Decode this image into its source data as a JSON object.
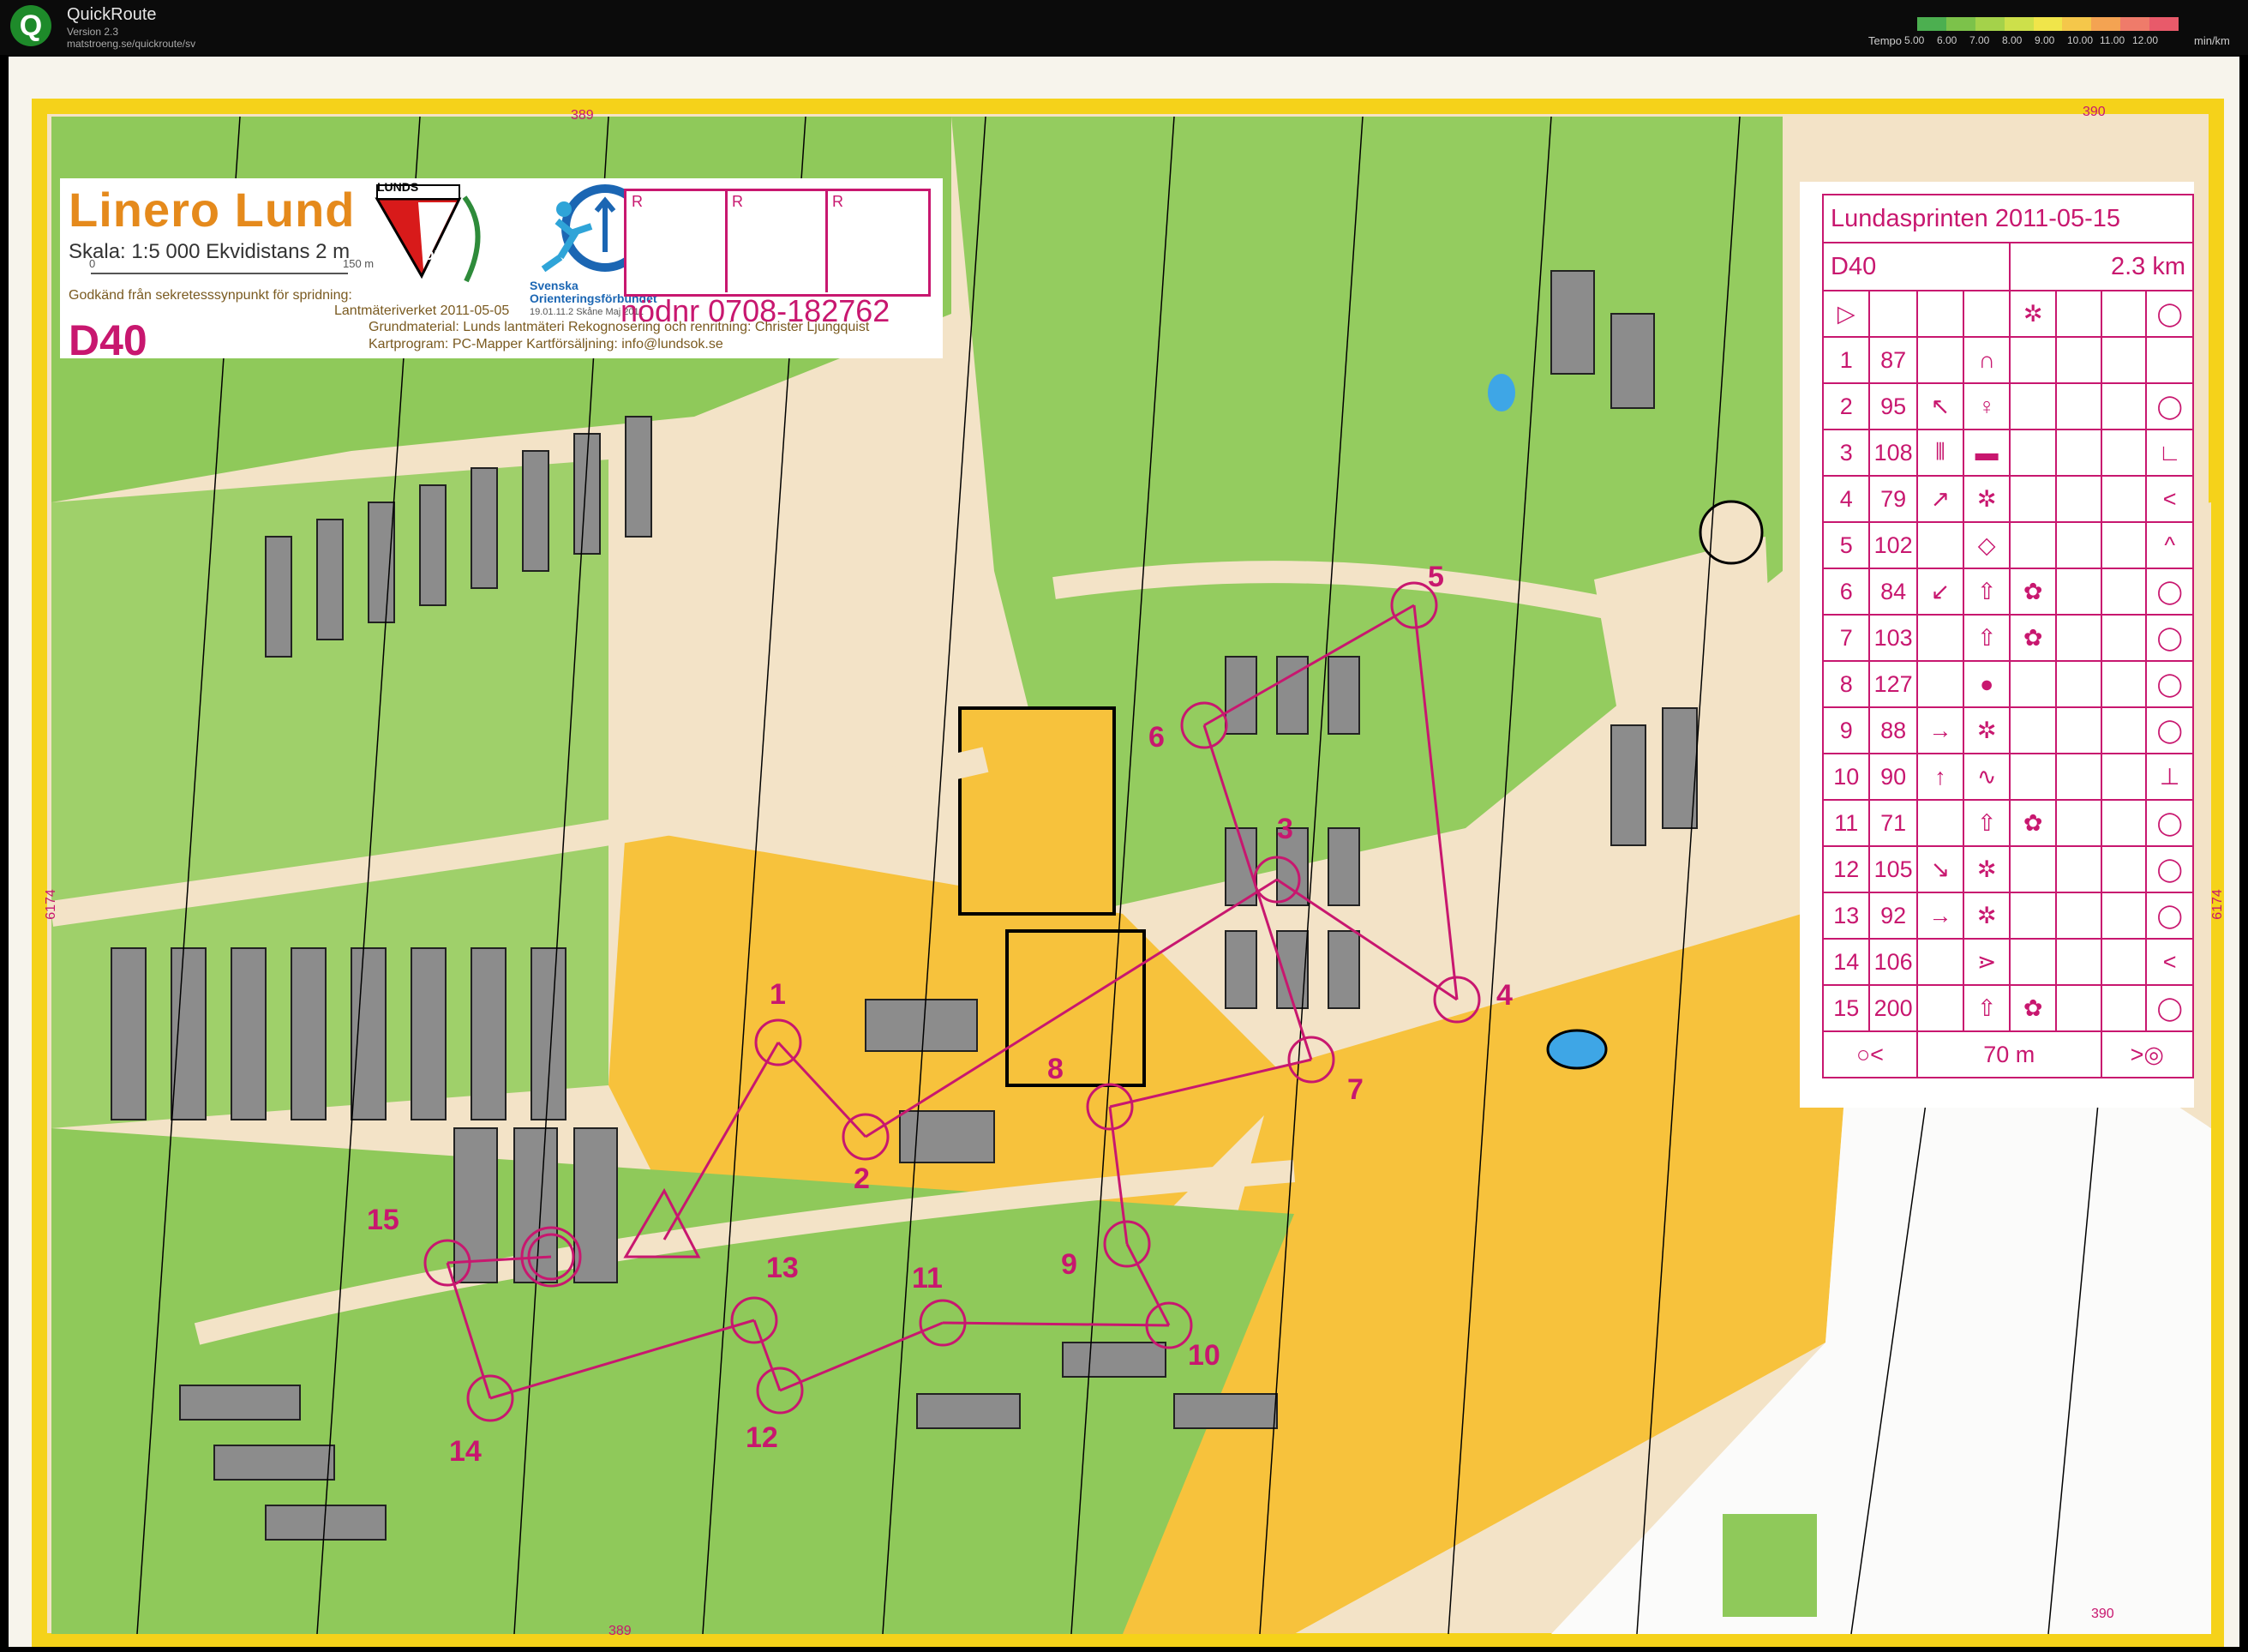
{
  "app": {
    "logo_letter": "Q",
    "title": "QuickRoute",
    "version": "Version 2.3",
    "url": "matstroeng.se/quickroute/sv",
    "tempo_label": "Tempo",
    "tempo_unit": "min/km",
    "tempo_ticks": [
      "5.00",
      "6.00",
      "7.00",
      "8.00",
      "9.00",
      "10.00",
      "11.00",
      "12.00"
    ],
    "tempo_colors": [
      "#4caf50",
      "#7cc24a",
      "#a4d24a",
      "#cde04a",
      "#f0e54a",
      "#f5c74a",
      "#f4a352",
      "#ef7b6a",
      "#e85a6a"
    ]
  },
  "map": {
    "title": "Linero Lund",
    "scale": "Skala: 1:5 000  Ekvidistans 2 m",
    "scale_start": "0",
    "scale_end": "150 m",
    "approval_1": "Godkänd från sekretesssynpunkt för spridning:",
    "approval_2": "Lantmäteriverket 2011-05-05",
    "class": "D40",
    "credits_1": "Grundmaterial: Lunds lantmäteri  Rekognosering och renritning: Christer Ljungquist",
    "credits_2": "Kartprogram: PC-Mapper              Kartförsäljning: info@lundsok.se",
    "club_top": "LUNDS",
    "club_bottom": "OK",
    "federation": "Svenska Orienteringsförbundet",
    "federation_date": "19.01.11.2   Skåne Maj 2011",
    "r_labels": [
      "R",
      "R",
      "R"
    ],
    "emergency": "nödnr 0708-182762",
    "grid": {
      "top_left": "389",
      "top_right": "390",
      "bottom_left": "389",
      "bottom_right": "390",
      "left": "6174",
      "right": "6174"
    },
    "controls": [
      "1",
      "2",
      "3",
      "4",
      "5",
      "6",
      "7",
      "8",
      "9",
      "10",
      "11",
      "12",
      "13",
      "14",
      "15"
    ],
    "colors": {
      "course": "#c8176f",
      "open": "#f7c23c",
      "forest": "#7cc24a",
      "building": "#8c8c8c",
      "paved": "#f3e3c7"
    }
  },
  "control_sheet": {
    "event": "Lundasprinten 2011-05-15",
    "class": "D40",
    "length": "2.3 km",
    "start_symbol": "▷",
    "start_feature": "✲",
    "start_position": "◯",
    "rows": [
      {
        "n": "1",
        "code": "87",
        "dir": "",
        "feature": "∩",
        "detail": "",
        "pos": ""
      },
      {
        "n": "2",
        "code": "95",
        "dir": "↖",
        "feature": "♀",
        "detail": "",
        "pos": "◯"
      },
      {
        "n": "3",
        "code": "108",
        "dir": "⫴",
        "feature": "▬",
        "detail": "",
        "pos": "∟"
      },
      {
        "n": "4",
        "code": "79",
        "dir": "↗",
        "feature": "✲",
        "detail": "",
        "pos": "<"
      },
      {
        "n": "5",
        "code": "102",
        "dir": "",
        "feature": "◇",
        "detail": "",
        "pos": "^"
      },
      {
        "n": "6",
        "code": "84",
        "dir": "↙",
        "feature": "⇧",
        "detail": "✿",
        "pos": "◯"
      },
      {
        "n": "7",
        "code": "103",
        "dir": "",
        "feature": "⇧",
        "detail": "✿",
        "pos": "◯"
      },
      {
        "n": "8",
        "code": "127",
        "dir": "",
        "feature": "●",
        "detail": "",
        "pos": "◯"
      },
      {
        "n": "9",
        "code": "88",
        "dir": "→",
        "feature": "✲",
        "detail": "",
        "pos": "◯"
      },
      {
        "n": "10",
        "code": "90",
        "dir": "↑",
        "feature": "∿",
        "detail": "",
        "pos": "⊥"
      },
      {
        "n": "11",
        "code": "71",
        "dir": "",
        "feature": "⇧",
        "detail": "✿",
        "pos": "◯"
      },
      {
        "n": "12",
        "code": "105",
        "dir": "↘",
        "feature": "✲",
        "detail": "",
        "pos": "◯"
      },
      {
        "n": "13",
        "code": "92",
        "dir": "→",
        "feature": "✲",
        "detail": "",
        "pos": "◯"
      },
      {
        "n": "14",
        "code": "106",
        "dir": "",
        "feature": "⋗",
        "detail": "",
        "pos": "<"
      },
      {
        "n": "15",
        "code": "200",
        "dir": "",
        "feature": "⇧",
        "detail": "✿",
        "pos": "◯"
      }
    ],
    "finish_left": "○<",
    "finish_dist": "70 m",
    "finish_right": ">◎"
  }
}
